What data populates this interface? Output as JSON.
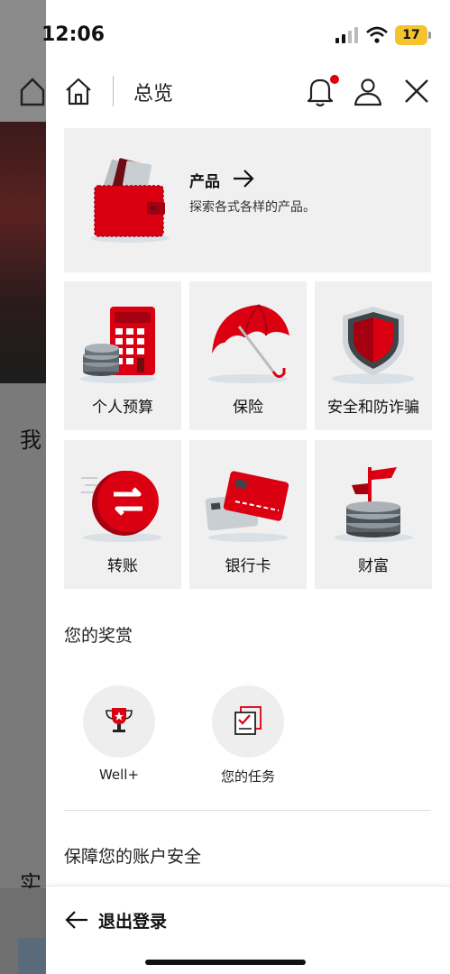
{
  "status_bar": {
    "time": "12:06",
    "battery": "17"
  },
  "background": {
    "char_top": "我",
    "char_bottom": "实"
  },
  "header": {
    "title": "总览"
  },
  "products": {
    "title": "产品",
    "subtitle": "探索各式各样的产品。"
  },
  "tiles": [
    {
      "label": "个人预算",
      "icon": "calculator-icon"
    },
    {
      "label": "保险",
      "icon": "umbrella-icon"
    },
    {
      "label": "安全和防诈骗",
      "icon": "shield-icon"
    },
    {
      "label": "转账",
      "icon": "transfer-coin-icon"
    },
    {
      "label": "银行卡",
      "icon": "bank-cards-icon"
    },
    {
      "label": "财富",
      "icon": "wealth-flag-icon"
    }
  ],
  "rewards": {
    "title": "您的奖赏",
    "items": [
      {
        "label": "Well+",
        "icon": "trophy-icon"
      },
      {
        "label": "您的任务",
        "icon": "task-checklist-icon"
      }
    ]
  },
  "security": {
    "title": "保障您的账户安全"
  },
  "footer": {
    "logout_label": "退出登录"
  },
  "colors": {
    "accent": "#db0011",
    "tile_bg": "#f0f0f0"
  }
}
